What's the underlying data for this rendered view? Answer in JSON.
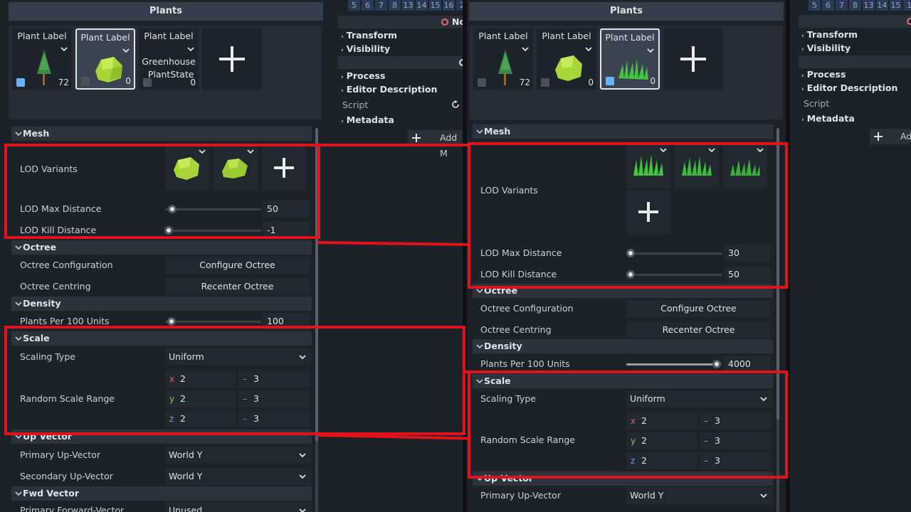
{
  "panel_title": "Plants",
  "plants_left": [
    {
      "label": "Plant Label",
      "count": "72",
      "checked": true,
      "thumb": "tree"
    },
    {
      "label": "Plant Label",
      "count": "0",
      "checked": false,
      "thumb": "rock",
      "selected": true
    },
    {
      "label": "Plant Label",
      "count": "0",
      "checked": false,
      "name_lines": [
        "Greenhouse",
        "_PlantState"
      ]
    }
  ],
  "plants_right": [
    {
      "label": "Plant Label",
      "count": "72",
      "checked": false,
      "thumb": "tree"
    },
    {
      "label": "Plant Label",
      "count": "0",
      "checked": false,
      "thumb": "rock"
    },
    {
      "label": "Plant Label",
      "count": "0",
      "checked": true,
      "thumb": "grass",
      "selected": true
    }
  ],
  "sections": {
    "mesh": "Mesh",
    "octree": "Octree",
    "density": "Density",
    "scale": "Scale",
    "up_vector": "Up Vector",
    "fwd_vector": "Fwd Vector"
  },
  "labels": {
    "lod_variants": "LOD Variants",
    "lod_max_distance": "LOD Max Distance",
    "lod_kill_distance": "LOD Kill Distance",
    "octree_configuration": "Octree Configuration",
    "octree_centring": "Octree Centring",
    "plants_per_100": "Plants Per 100 Units",
    "scaling_type": "Scaling Type",
    "random_scale_range": "Random Scale Range",
    "primary_up": "Primary Up-Vector",
    "secondary_up": "Secondary Up-Vector",
    "primary_fwd": "Primary Forward-Vector"
  },
  "buttons": {
    "configure_octree": "Configure Octree",
    "recenter_octree": "Recenter Octree"
  },
  "left_values": {
    "lod_max_distance": "50",
    "lod_kill_distance": "-1",
    "plants_per_100": "100",
    "scaling_type": "Uniform",
    "scale_x_min": "2",
    "scale_x_max": "3",
    "scale_y_min": "2",
    "scale_y_max": "3",
    "scale_z_min": "2",
    "scale_z_max": "3",
    "primary_up": "World Y",
    "secondary_up": "World Y",
    "primary_fwd": "Unused"
  },
  "right_values": {
    "lod_max_distance": "30",
    "lod_kill_distance": "50",
    "plants_per_100": "4000",
    "scaling_type": "Uniform",
    "scale_x_min": "2",
    "scale_x_max": "3",
    "scale_y_min": "2",
    "scale_y_max": "3",
    "scale_z_min": "2",
    "scale_z_max": "3",
    "primary_up": "World Y"
  },
  "axis": {
    "x": "x",
    "y": "y",
    "z": "z",
    "minus": "–"
  },
  "layer_numbers_left": [
    "5",
    "6",
    "7",
    "8",
    "13",
    "14",
    "15",
    "16",
    "2"
  ],
  "layer_numbers_right": [
    "5",
    "6",
    "7",
    "8",
    "13",
    "14",
    "15",
    "1"
  ],
  "inspector": {
    "node_left": "No",
    "node_right": "N",
    "transform": "Transform",
    "visibility": "Visibility",
    "process": "Process",
    "editor_description": "Editor Description",
    "script": "Script",
    "metadata": "Metadata",
    "add_metadata": "Add M",
    "add_metadata_right": "Ad"
  },
  "colors": {
    "highlight": "#e0121b",
    "accent_check": "#6cb2f0"
  }
}
